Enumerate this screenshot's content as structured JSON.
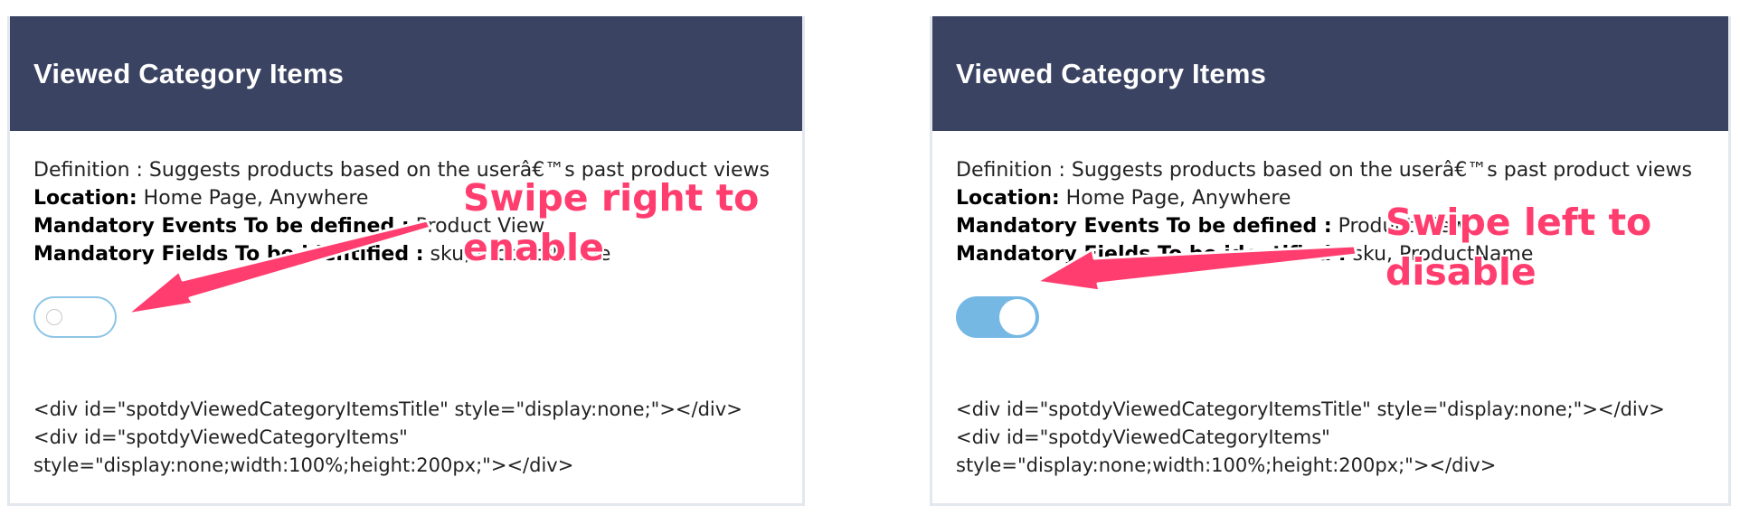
{
  "left_card": {
    "title": "Viewed Category Items",
    "definition": "Definition : Suggests products based on the userâ€™s past product views",
    "location_label": "Location:",
    "location_value": " Home Page, Anywhere",
    "events_label": "Mandatory Events To be defined :",
    "events_value": " Product View",
    "fields_label": "Mandatory Fields To be identified :",
    "fields_value": " sku, ProductName",
    "toggle_state": "off",
    "code_line1": "<div id=\"spotdyViewedCategoryItemsTitle\" style=\"display:none;\"></div>",
    "code_line2": "<div id=\"spotdyViewedCategoryItems\"",
    "code_line3": "style=\"display:none;width:100%;height:200px;\"></div>"
  },
  "right_card": {
    "title": "Viewed Category Items",
    "definition": "Definition : Suggests products based on the userâ€™s past product views",
    "location_label": "Location:",
    "location_value": " Home Page, Anywhere",
    "events_label": "Mandatory Events To be defined :",
    "events_value": " Product View",
    "fields_label": "Mandatory Fields To be identified :",
    "fields_value": " sku, ProductName",
    "toggle_state": "on",
    "code_line1": "<div id=\"spotdyViewedCategoryItemsTitle\" style=\"display:none;\"></div>",
    "code_line2": "<div id=\"spotdyViewedCategoryItems\"",
    "code_line3": "style=\"display:none;width:100%;height:200px;\"></div>"
  },
  "annotations": {
    "left": "Swipe right to\nenable",
    "right": "Swipe left to\ndisable"
  },
  "colors": {
    "header_bg": "#3a4362",
    "annotation": "#ff3d6e",
    "toggle_on": "#76b8e4",
    "toggle_off_border": "#8fc5e6"
  }
}
